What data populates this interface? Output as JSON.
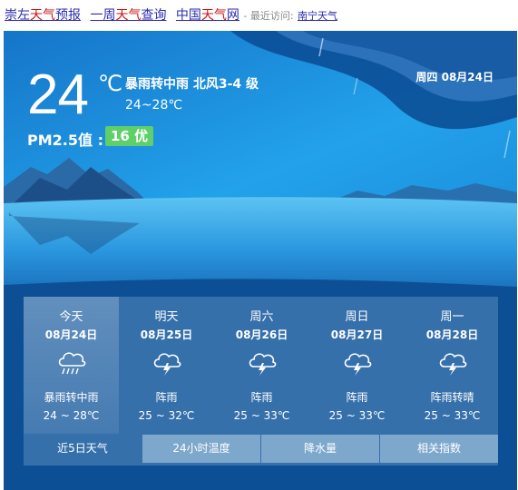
{
  "top_links": {
    "link1": {
      "prefix": "崇左",
      "mid": "天气",
      "suffix": "预报"
    },
    "link2": {
      "prefix": "一周",
      "mid": "天气",
      "suffix": "查询"
    },
    "link3": {
      "prefix": "中国",
      "mid": "天气",
      "suffix": "网"
    },
    "recent_label": "- 最近访问:",
    "recent_city": "南宁天气"
  },
  "current": {
    "temp": "24",
    "unit": "℃",
    "condition": "暴雨转中雨 北风3-4 级",
    "range": "24~28℃",
    "date": "周四  08月24日",
    "pm_label": "PM2.5值 :",
    "aqi": "16 优"
  },
  "forecast": [
    {
      "name": "今天",
      "date": "08月24日",
      "icon": "heavy-rain-icon",
      "desc": "暴雨转中雨",
      "temp": "24 ~ 28℃"
    },
    {
      "name": "明天",
      "date": "08月25日",
      "icon": "thunderstorm-icon",
      "desc": "阵雨",
      "temp": "25 ~ 32℃"
    },
    {
      "name": "周六",
      "date": "08月26日",
      "icon": "thunderstorm-icon",
      "desc": "阵雨",
      "temp": "25 ~ 33℃"
    },
    {
      "name": "周日",
      "date": "08月27日",
      "icon": "thunderstorm-icon",
      "desc": "阵雨",
      "temp": "25 ~ 33℃"
    },
    {
      "name": "周一",
      "date": "08月28日",
      "icon": "thunderstorm-icon",
      "desc": "阵雨转晴",
      "temp": "25 ~ 33℃"
    }
  ],
  "tabs": [
    "近5日天气",
    "24小时温度",
    "降水量",
    "相关指数"
  ],
  "colors": {
    "aqi_good": "#5fcf6a",
    "link_blue": "#2b2bb0",
    "link_red": "#cc1111"
  }
}
